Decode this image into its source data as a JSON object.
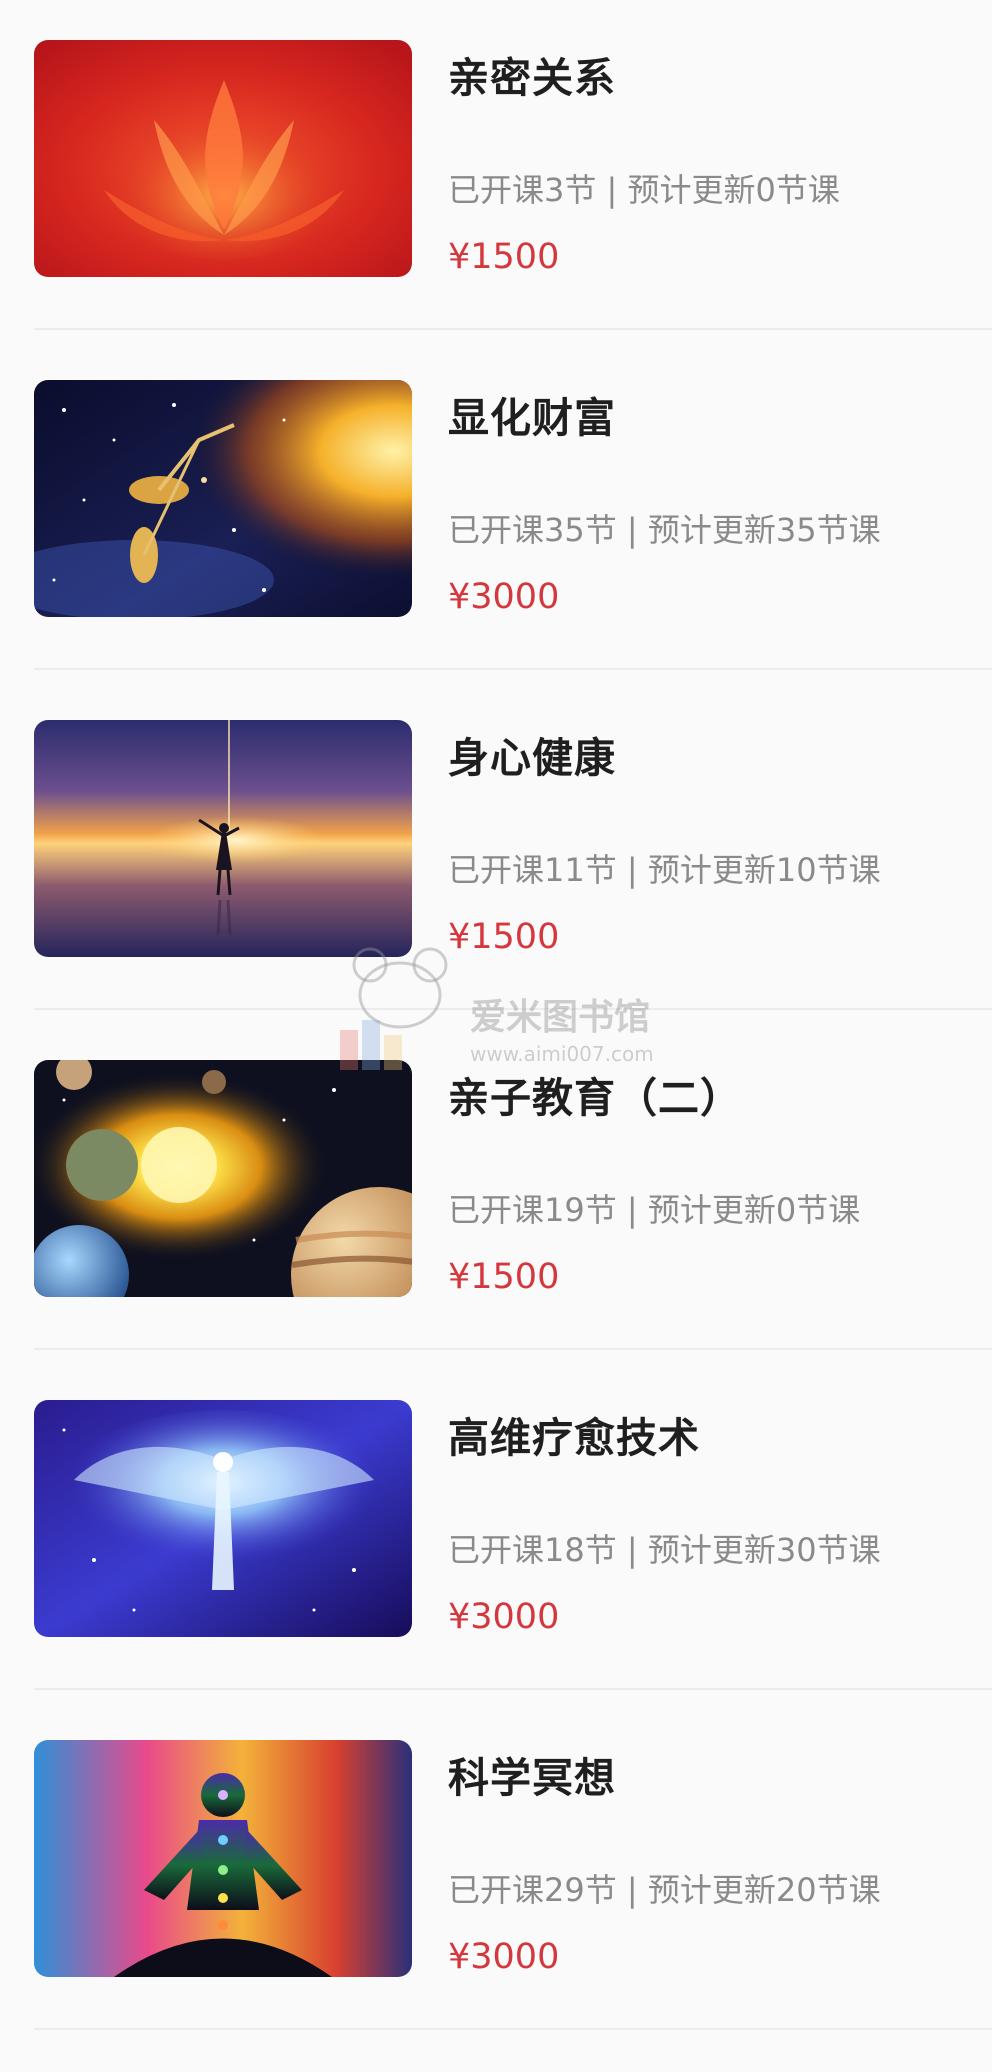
{
  "courses": [
    {
      "title": "亲密关系",
      "meta": "已开课3节 | 预计更新0节课",
      "price": "¥1500",
      "image": "red-flame-lotus"
    },
    {
      "title": "显化财富",
      "meta": "已开课35节 | 预计更新35节课",
      "price": "¥3000",
      "image": "cosmic-scales-galaxy"
    },
    {
      "title": "身心健康",
      "meta": "已开课11节 | 预计更新10节课",
      "price": "¥1500",
      "image": "sunset-woman-silhouette"
    },
    {
      "title": "亲子教育（二）",
      "meta": "已开课19节 | 预计更新0节课",
      "price": "¥1500",
      "image": "solar-system-planets"
    },
    {
      "title": "高维疗愈技术",
      "meta": "已开课18节 | 预计更新30节课",
      "price": "¥3000",
      "image": "glowing-angel-figure"
    },
    {
      "title": "科学冥想",
      "meta": "已开课29节 | 预计更新20节课",
      "price": "¥3000",
      "image": "meditating-chakra-silhouette"
    }
  ],
  "watermark": {
    "text": "爱米图书馆",
    "url": "www.aimi007.com"
  },
  "colors": {
    "price": "#d4383e",
    "title": "#1f1f1f",
    "meta": "#8a8a8a",
    "background": "#fafafa"
  }
}
